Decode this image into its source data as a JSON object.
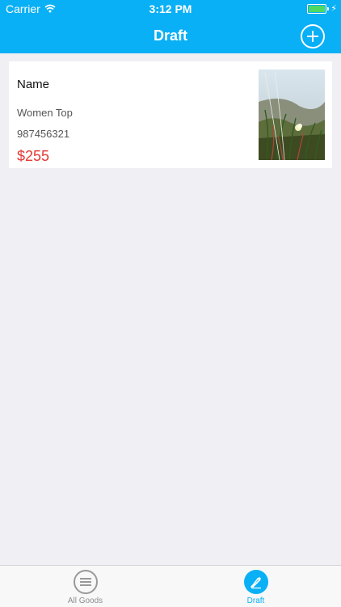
{
  "status_bar": {
    "carrier": "Carrier",
    "time": "3:12 PM"
  },
  "nav": {
    "title": "Draft",
    "add_icon": "plus-circle-icon"
  },
  "draft_item": {
    "name": "Name",
    "category": "Women Top",
    "code": "987456321",
    "price": "$255",
    "photo": "grass-flower-photo"
  },
  "tabbar": {
    "tabs": [
      {
        "label": "All Goods",
        "icon": "list-icon",
        "selected": false
      },
      {
        "label": "Draft",
        "icon": "pencil-icon",
        "selected": true
      }
    ]
  },
  "colors": {
    "accent": "#09b0f5",
    "price": "#e53935",
    "background": "#efeff4"
  }
}
